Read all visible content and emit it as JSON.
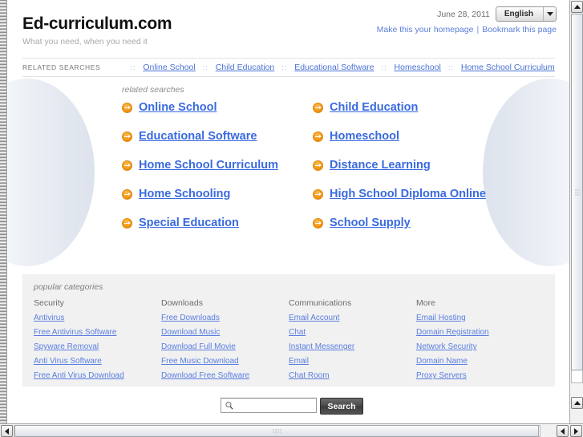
{
  "header": {
    "site_title": "Ed-curriculum.com",
    "tagline": "What you need, when you need it",
    "date": "June 28, 2011",
    "language": "English",
    "homepage_link": "Make this your homepage",
    "bookmark_link": "Bookmark this page",
    "link_separator": "|"
  },
  "related_bar": {
    "label": "RELATED SEARCHES",
    "separator": "::",
    "items": [
      "Online School",
      "Child Education",
      "Educational Software",
      "Homeschool",
      "Home School Curriculum"
    ]
  },
  "main": {
    "heading": "related searches",
    "links": [
      "Online School",
      "Child Education",
      "Educational Software",
      "Homeschool",
      "Home School Curriculum",
      "Distance Learning",
      "Home Schooling",
      "High School Diploma Online",
      "Special Education",
      "School Supply"
    ]
  },
  "popular": {
    "heading": "popular categories",
    "columns": [
      {
        "title": "Security",
        "links": [
          "Antivirus",
          "Free Antivirus Software",
          "Spyware Removal",
          "Anti Virus Software",
          "Free Anti Virus Download"
        ]
      },
      {
        "title": "Downloads",
        "links": [
          "Free Downloads",
          "Download Music",
          "Download Full Movie",
          "Free Music Download",
          "Download Free Software"
        ]
      },
      {
        "title": "Communications",
        "links": [
          "Email Account",
          "Chat",
          "Instant Messenger",
          "Email",
          "Chat Room"
        ]
      },
      {
        "title": "More",
        "links": [
          "Email Hosting",
          "Domain Registration",
          "Network Security",
          "Domain Name",
          "Proxy Servers"
        ]
      }
    ]
  },
  "search": {
    "value": "",
    "placeholder": "",
    "button_label": "Search"
  },
  "colors": {
    "link_blue": "#3a6ae0",
    "arrow_orange": "#f59a18",
    "panel_gray": "#f1f1f1",
    "button_dark": "#4a4a4a"
  }
}
